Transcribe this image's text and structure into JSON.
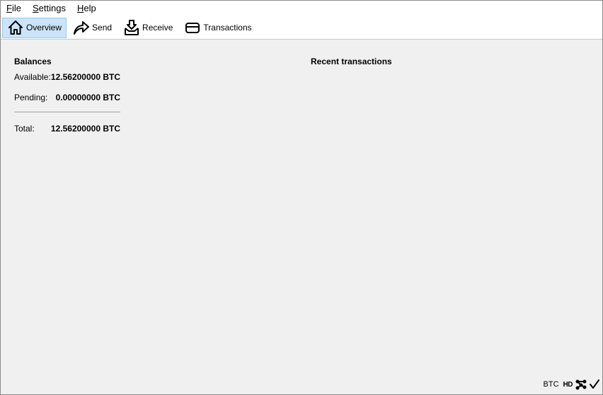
{
  "menu": {
    "file": {
      "accel": "F",
      "rest": "ile"
    },
    "settings": {
      "accel": "S",
      "rest": "ettings"
    },
    "help": {
      "accel": "H",
      "rest": "elp"
    }
  },
  "toolbar": {
    "overview": {
      "label": "Overview",
      "icon": "home-icon",
      "active": true
    },
    "send": {
      "label": "Send",
      "icon": "send-arrow-icon"
    },
    "receive": {
      "label": "Receive",
      "icon": "receive-inbox-icon"
    },
    "transactions": {
      "label": "Transactions",
      "icon": "card-icon"
    }
  },
  "balances": {
    "title": "Balances",
    "available": {
      "label": "Available:",
      "value": "12.56200000 BTC"
    },
    "pending": {
      "label": "Pending:",
      "value": "0.00000000 BTC"
    },
    "total": {
      "label": "Total:",
      "value": "12.56200000 BTC"
    }
  },
  "recent": {
    "title": "Recent transactions"
  },
  "status": {
    "unit": "BTC",
    "hd": "HD",
    "network_icon": "network-icon",
    "sync_icon": "checkmark-icon"
  }
}
